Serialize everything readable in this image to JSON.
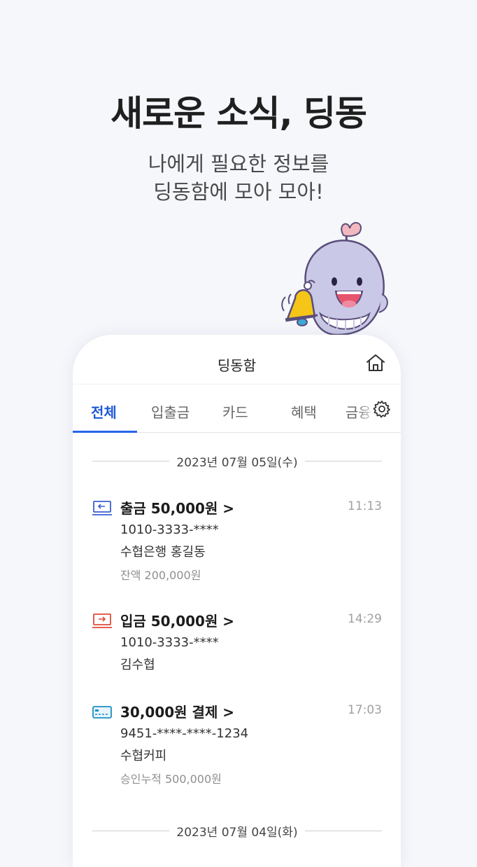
{
  "hero": {
    "title": "새로운 소식, 딩동",
    "subtitle_line1": "나에게 필요한 정보를",
    "subtitle_line2": "딩동함에 모아 모아!"
  },
  "app": {
    "title": "딩동함",
    "tabs": [
      {
        "label": "전체",
        "active": true
      },
      {
        "label": "입출금",
        "active": false
      },
      {
        "label": "카드",
        "active": false
      },
      {
        "label": "혜택",
        "active": false
      },
      {
        "label": "금융",
        "active": false
      }
    ]
  },
  "feed": {
    "date1": "2023년 07월 05일(수)",
    "date2": "2023년 07월 04일(화)",
    "transactions": [
      {
        "icon": "withdraw-icon",
        "title": "출금 50,000원 >",
        "time": "11:13",
        "account": "1010-3333-****",
        "detail": "수협은행 홍길동",
        "extra": "잔액 200,000원"
      },
      {
        "icon": "deposit-icon",
        "title": "입금 50,000원 >",
        "time": "14:29",
        "account": "1010-3333-****",
        "detail": "김수협",
        "extra": ""
      },
      {
        "icon": "card-icon",
        "title": "30,000원 결제 >",
        "time": "17:03",
        "account": "9451-****-****-1234",
        "detail": "수협커피",
        "extra": "승인누적 500,000원"
      }
    ]
  },
  "colors": {
    "accent": "#2563eb",
    "withdraw": "#3b5fd1",
    "deposit": "#e04a3a",
    "card": "#1a8fc4",
    "bell": "#f5c518",
    "mascot_body": "#c9c8e6"
  }
}
